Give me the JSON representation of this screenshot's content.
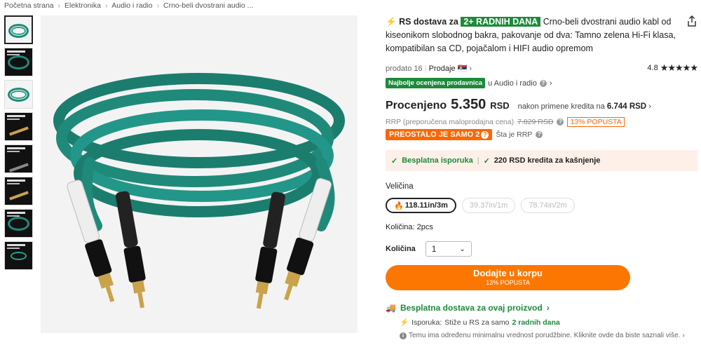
{
  "breadcrumb": [
    "Početna strana",
    "Elektronika",
    "Audio i radio",
    "Crno-beli dvostrani audio ..."
  ],
  "product": {
    "ship_prefix": "RS dostava za",
    "ship_days": "2+ RADNIH DANA",
    "title": "Crno-beli dvostrani audio kabl od kiseonikom slobodnog bakra, pakovanje od dva: Tamno zelena Hi-Fi klasa, kompatibilan sa CD, pojačalom i HIFI audio opremom"
  },
  "meta": {
    "sold": "prodato 16",
    "seller_label": "Prodaje",
    "rating": "4.8",
    "stars": "★★★★★"
  },
  "best": {
    "badge": "Najbolje ocenjena prodavnica",
    "category": "u Audio i radio"
  },
  "price": {
    "label": "Procenjeno",
    "value": "5.350",
    "currency": "RSD",
    "credit_prefix": "nakon primene kredita na",
    "credit_value": "6.744 RSD"
  },
  "rrp": {
    "label": "RRP (preporučena maloprodajna cena)",
    "old": "7.829 RSD",
    "discount": "13% POPUSTA"
  },
  "stock": {
    "badge": "PREOSTALO JE SAMO 2",
    "rrp_link": "Šta je RRP"
  },
  "benefits": {
    "free": "Besplatna isporuka",
    "credit": "220 RSD kredita za kašnjenje"
  },
  "size": {
    "label": "Veličina",
    "options": [
      "118.11in/3m",
      "39.37in/1m",
      "78.74in/2m"
    ]
  },
  "quantity": {
    "pack_label": "Količina: 2pcs",
    "label": "Količina",
    "value": "1"
  },
  "cart": {
    "label": "Dodajte u korpu",
    "sub": "13% POPUSTA"
  },
  "shipping": {
    "free_title": "Besplatna dostava za ovaj proizvod",
    "delivery_label": "Isporuka:",
    "delivery_text": "Stiže u RS za samo",
    "delivery_days": "2 radnih dana",
    "note": "Temu ima određenu minimalnu vrednost porudžbine. Kliknite ovde da biste saznali više."
  },
  "colors": {
    "accent": "#fb7701",
    "green": "#1c8a3a",
    "cable": "#1f8a7a"
  }
}
